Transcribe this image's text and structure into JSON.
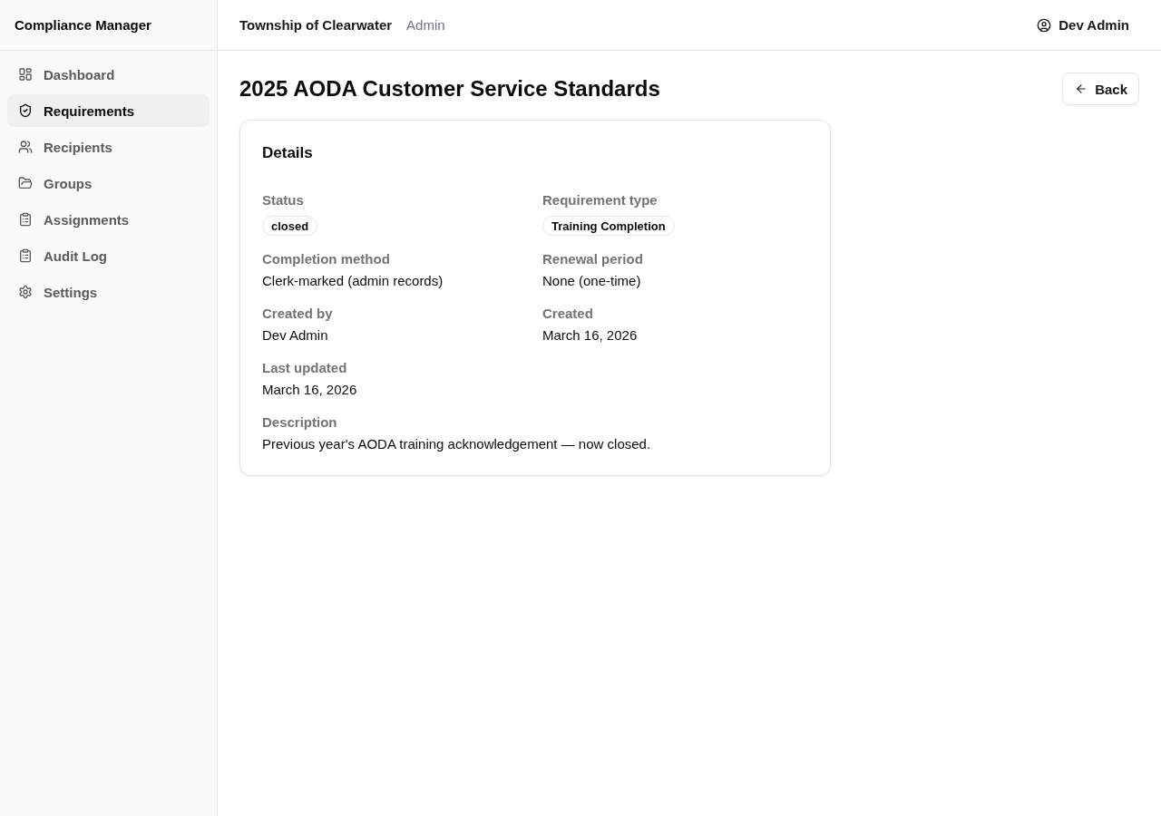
{
  "sidebar": {
    "title": "Compliance Manager",
    "items": [
      {
        "label": "Dashboard",
        "selected": false
      },
      {
        "label": "Requirements",
        "selected": true
      },
      {
        "label": "Recipients",
        "selected": false
      },
      {
        "label": "Groups",
        "selected": false
      },
      {
        "label": "Assignments",
        "selected": false
      },
      {
        "label": "Audit Log",
        "selected": false
      },
      {
        "label": "Settings",
        "selected": false
      }
    ]
  },
  "header": {
    "organization": "Township of Clearwater",
    "role": "Admin",
    "user": "Dev Admin"
  },
  "page": {
    "title": "2025 AODA Customer Service Standards",
    "back_button": "Back"
  },
  "details": {
    "title": "Details",
    "fields": [
      {
        "label": "Status",
        "value": "closed",
        "kind": "badge"
      },
      {
        "label": "Requirement type",
        "value": "Training Completion",
        "kind": "badge"
      },
      {
        "label": "Completion method",
        "value": "Clerk-marked (admin records)",
        "kind": "text"
      },
      {
        "label": "Renewal period",
        "value": "None (one-time)",
        "kind": "text"
      },
      {
        "label": "Created by",
        "value": "Dev Admin",
        "kind": "text"
      },
      {
        "label": "Created",
        "value": "March 16, 2026",
        "kind": "text"
      },
      {
        "label": "Last updated",
        "value": "March 16, 2026",
        "kind": "text"
      },
      {
        "label": "Description",
        "value": "Previous year's AODA training acknowledgement — now closed.",
        "kind": "paragraph"
      }
    ]
  }
}
